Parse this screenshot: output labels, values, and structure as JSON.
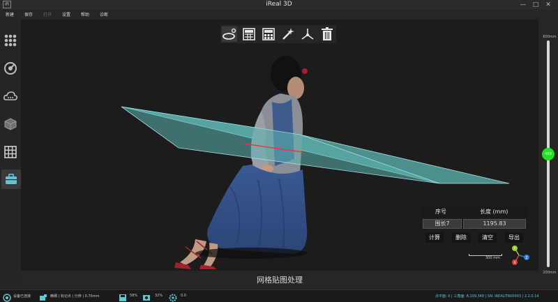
{
  "window": {
    "title": "iReal 3D",
    "logo": "iR",
    "controls": [
      "—",
      "□",
      "✕"
    ]
  },
  "menu": {
    "items": [
      {
        "label": "新建",
        "enabled": true
      },
      {
        "label": "保存",
        "enabled": true
      },
      {
        "label": "打开",
        "enabled": false
      },
      {
        "label": "设置",
        "enabled": true
      },
      {
        "label": "帮助",
        "enabled": true
      },
      {
        "label": "诊断",
        "enabled": true
      }
    ]
  },
  "left_toolbar": {
    "tools": [
      {
        "icon": "grid-dots-icon"
      },
      {
        "icon": "scan-icon"
      },
      {
        "icon": "cloud-icon"
      },
      {
        "icon": "cube-icon"
      },
      {
        "icon": "mesh-grid-icon"
      },
      {
        "icon": "toolbox-icon",
        "active": true
      }
    ],
    "subtools": [
      {
        "icon": "measure-search-icon",
        "active": true
      },
      {
        "icon": "rotate-eye-icon",
        "active": false
      }
    ]
  },
  "viewport_toolbar": {
    "tools": [
      {
        "icon": "ellipse-measure-icon",
        "selected": true
      },
      {
        "icon": "calculator-icon"
      },
      {
        "icon": "grid-calculator-icon"
      },
      {
        "icon": "magic-wand-icon"
      },
      {
        "icon": "axis-triad-icon"
      },
      {
        "icon": "trash-icon"
      }
    ]
  },
  "measure_table": {
    "headers": [
      "序号",
      "长度 (mm)"
    ],
    "rows": [
      {
        "name": "围长7",
        "length": "1195.83"
      }
    ],
    "buttons": [
      "计算",
      "删除",
      "清空",
      "导出"
    ]
  },
  "scale_bar": {
    "label": "300 mm"
  },
  "axes": {
    "x": "X",
    "y": "Y",
    "z": "Z",
    "colors": {
      "x": "#e23a3a",
      "y": "#9ad323",
      "z": "#2a7be4"
    }
  },
  "process_label": "网格贴图处理",
  "right_slider": {
    "top_label": "600mm",
    "bottom_label": "200mm",
    "value_label": "400",
    "value_fraction": 0.5,
    "thumb_color": "#22e022"
  },
  "status": {
    "left": [
      {
        "icon": "device-icon",
        "text": "设备已连接"
      },
      {
        "icon": "snap-icon",
        "text": "精细 | 标记点 | 分辨 | 0.70mm"
      },
      {
        "icon": "floppy-icon",
        "text": "58%"
      },
      {
        "icon": "camera-icon",
        "text": "32%"
      },
      {
        "icon": "gear-icon",
        "text": "0.0"
      }
    ],
    "right": "点平面: 0 | 三角面: 8,109,348 | SN: IREALIT800003 | 2.2.0.14"
  },
  "colors": {
    "accent": "#5bc8d4",
    "plane_fill": "#5db6b2",
    "active_tool": "#c8202c"
  }
}
